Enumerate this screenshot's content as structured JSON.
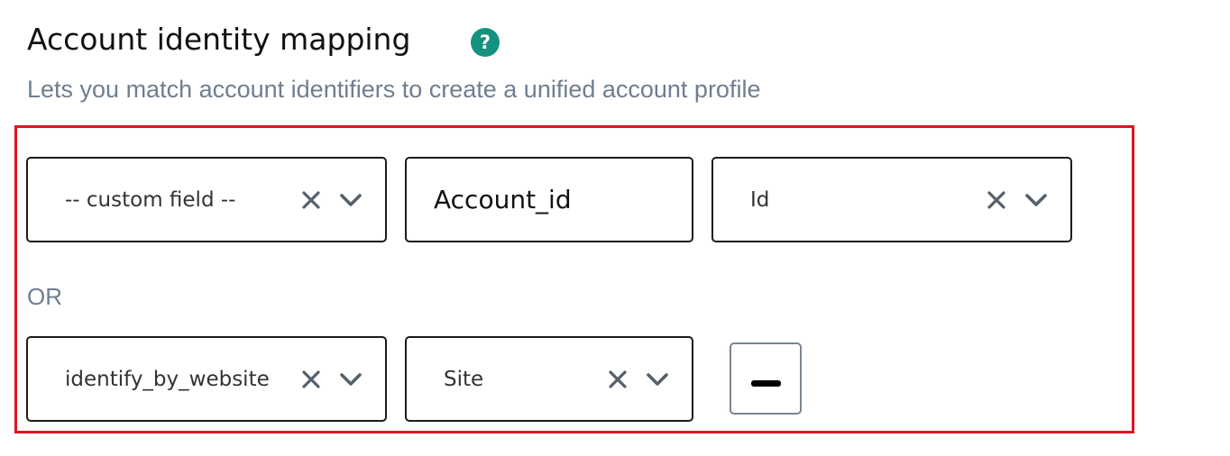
{
  "section": {
    "title": "Account identity mapping",
    "help_glyph": "?",
    "subtitle": "Lets you match account identifiers to create a unified account profile"
  },
  "colors": {
    "help_icon_bg": "#14917f",
    "highlight_border": "#e0141e",
    "muted_text": "#6f7e91",
    "icon_gray": "#56606b"
  },
  "rule1": {
    "field_select": {
      "value": "-- custom field --"
    },
    "field_input": {
      "value": "Account_id"
    },
    "target_select": {
      "value": "Id"
    }
  },
  "separator": "OR",
  "rule2": {
    "field_select": {
      "value": "identify_by_website"
    },
    "target_select": {
      "value": "Site"
    }
  },
  "icons": {
    "clear": "close-icon",
    "dropdown": "chevron-down-icon",
    "remove": "minus-icon",
    "help": "help-question-icon"
  }
}
